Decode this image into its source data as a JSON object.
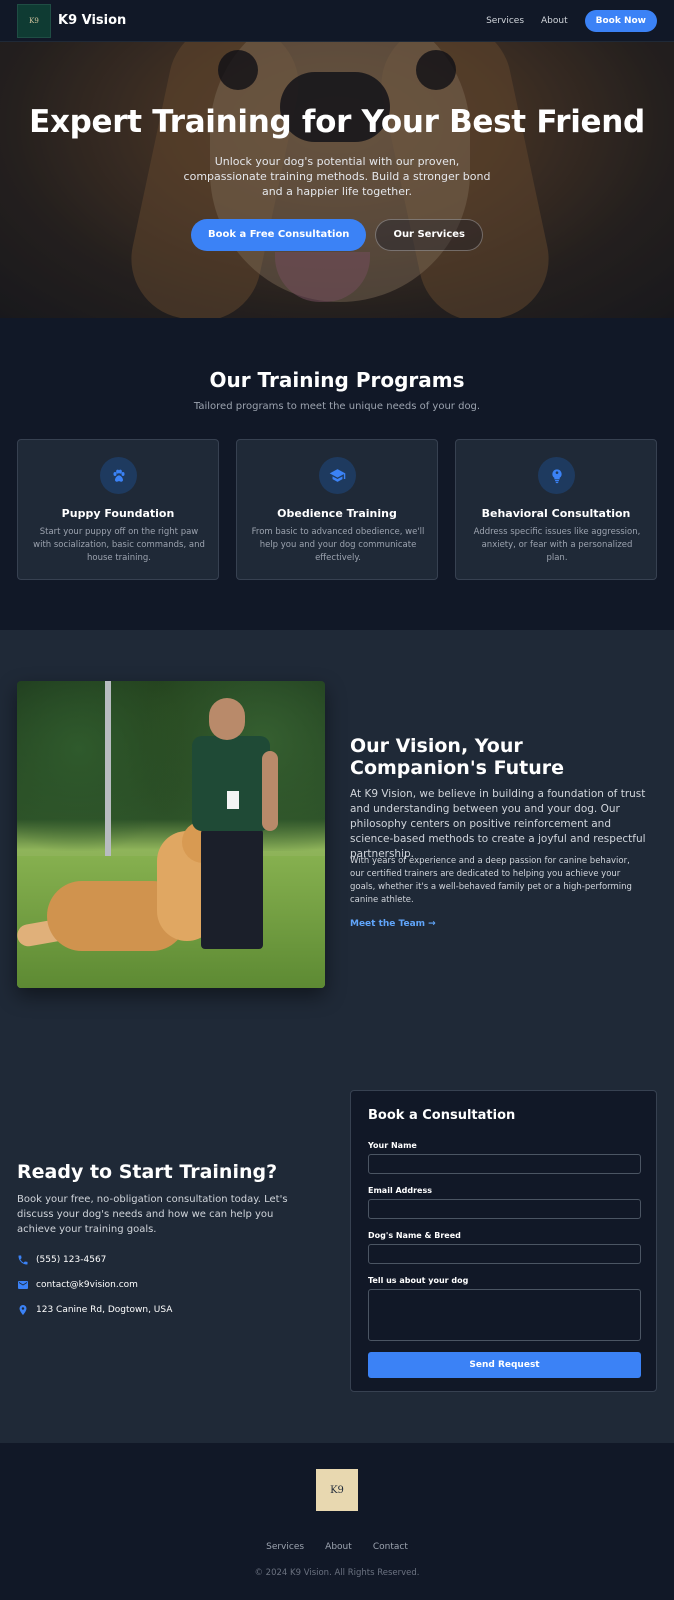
{
  "header": {
    "logo_text": "K9",
    "brand": "K9 Vision",
    "nav": [
      "Services",
      "About"
    ],
    "cta": "Book Now"
  },
  "hero": {
    "title": "Expert Training for Your Best Friend",
    "subtitle": "Unlock your dog's potential with our proven, compassionate training methods. Build a stronger bond and a happier life together.",
    "primary_cta": "Book a Free Consultation",
    "secondary_cta": "Our Services"
  },
  "programs": {
    "title": "Our Training Programs",
    "subtitle": "Tailored programs to meet the unique needs of your dog.",
    "cards": [
      {
        "icon": "paw-icon",
        "title": "Puppy Foundation",
        "text": "Start your puppy off on the right paw with socialization, basic commands, and house training."
      },
      {
        "icon": "graduation-cap-icon",
        "title": "Obedience Training",
        "text": "From basic to advanced obedience, we'll help you and your dog communicate effectively."
      },
      {
        "icon": "brain-icon",
        "title": "Behavioral Consultation",
        "text": "Address specific issues like aggression, anxiety, or fear with a personalized plan."
      }
    ]
  },
  "vision": {
    "title": "Our Vision, Your Companion's Future",
    "p1": "At K9 Vision, we believe in building a foundation of trust and understanding between you and your dog. Our philosophy centers on positive reinforcement and science-based methods to create a joyful and respectful partnership.",
    "p2": "With years of experience and a deep passion for canine behavior, our certified trainers are dedicated to helping you achieve your goals, whether it's a well-behaved family pet or a high-performing canine athlete.",
    "link": "Meet the Team →"
  },
  "contact": {
    "title": "Ready to Start Training?",
    "desc": "Book your free, no-obligation consultation today. Let's discuss your dog's needs and how we can help you achieve your training goals.",
    "phone": "(555) 123-4567",
    "email": "contact@k9vision.com",
    "address": "123 Canine Rd, Dogtown, USA",
    "form": {
      "title": "Book a Consultation",
      "name_label": "Your Name",
      "email_label": "Email Address",
      "dog_label": "Dog's Name & Breed",
      "about_label": "Tell us about your dog",
      "submit": "Send Request"
    }
  },
  "footer": {
    "logo_text": "K9",
    "nav": [
      "Services",
      "About",
      "Contact"
    ],
    "copyright": "© 2024 K9 Vision. All Rights Reserved."
  },
  "colors": {
    "accent": "#3b82f6",
    "link": "#60a5fa",
    "bg_dark": "#111827",
    "bg_section": "#1f2937"
  }
}
